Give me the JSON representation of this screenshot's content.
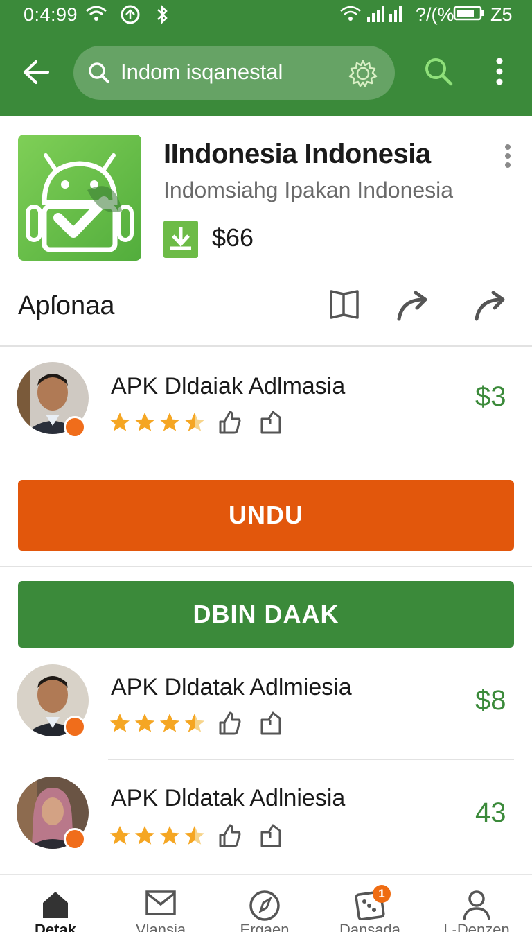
{
  "status_bar": {
    "time": "0:4:99",
    "signal_text": "?/(%",
    "battery_text": "Z5"
  },
  "toolbar": {
    "search_text": "Indom isqanestal",
    "icons": [
      "back-arrow-icon",
      "search-icon",
      "settings-gear-icon",
      "search-icon",
      "more-vert-icon"
    ]
  },
  "app": {
    "title": "IIndonesia Indonesia",
    "subtitle": "Indomsiahg Ipakan Indonesia",
    "price": "$66"
  },
  "section": {
    "title": "Apſonaa"
  },
  "reviews": [
    {
      "title": "APK Dldaiak Adlmasia",
      "price": "$3",
      "rating": 3.5
    },
    {
      "title": "APK Dldatak Adlmiesia",
      "price": "$8",
      "rating": 3.5
    },
    {
      "title": "APK Dldatak Adlniesia",
      "price": "43",
      "rating": 3.5
    }
  ],
  "buttons": {
    "download_label": "UNDU",
    "secondary_label": "DBIN DAAK"
  },
  "bottom_nav": {
    "items": [
      {
        "label": "Detak",
        "icon": "home-icon",
        "active": true
      },
      {
        "label": "Vlansia",
        "icon": "mail-icon",
        "active": false
      },
      {
        "label": "Ergaen",
        "icon": "compass-icon",
        "active": false
      },
      {
        "label": "Dansada",
        "icon": "dice-icon",
        "active": false,
        "badge": "1"
      },
      {
        "label": "L-Denzen",
        "icon": "person-icon",
        "active": false
      }
    ]
  },
  "colors": {
    "primary_green": "#3b8a3a",
    "accent_orange": "#e2570c",
    "star": "#f5a623"
  }
}
